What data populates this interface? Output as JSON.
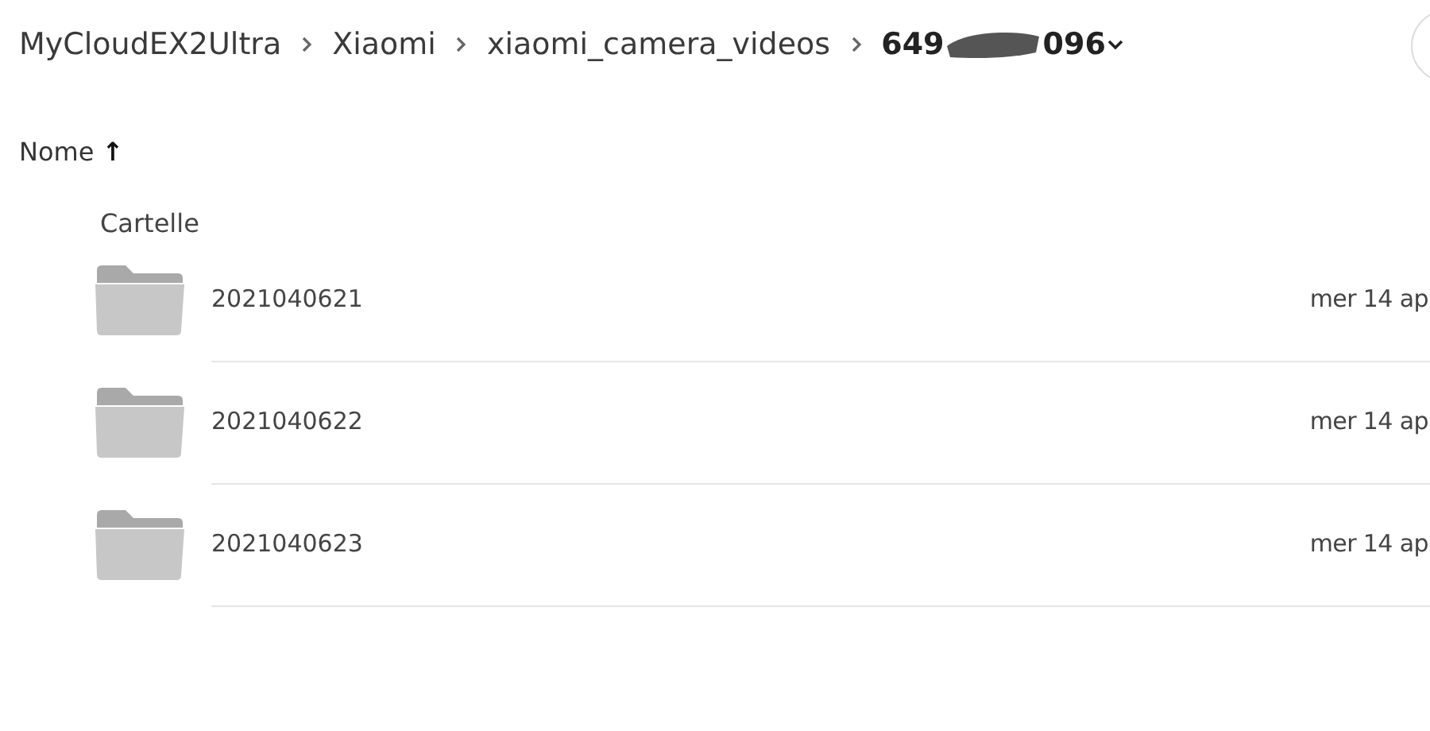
{
  "breadcrumb": {
    "items": [
      "MyCloudEX2Ultra",
      "Xiaomi",
      "xiaomi_camera_videos"
    ],
    "current": {
      "visible_start": "649",
      "visible_end": "096",
      "redacted": true
    }
  },
  "sort": {
    "label": "Nome",
    "arrow": "↑"
  },
  "section": "Cartelle",
  "folders": [
    {
      "name": "2021040621",
      "date": "mer 14 ap"
    },
    {
      "name": "2021040622",
      "date": "mer 14 ap"
    },
    {
      "name": "2021040623",
      "date": "mer 14 ap"
    }
  ]
}
